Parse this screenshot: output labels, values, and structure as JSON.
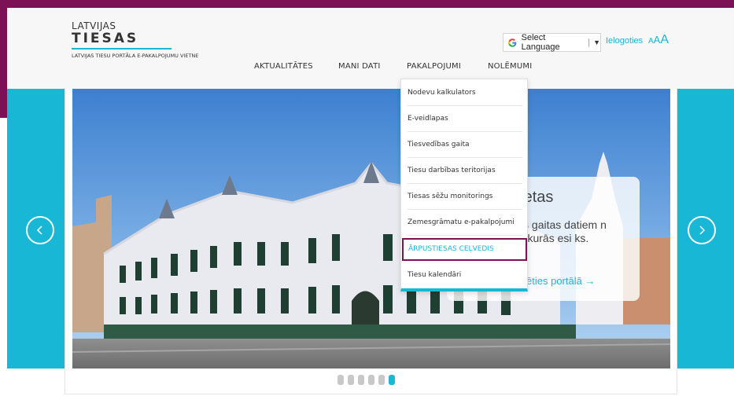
{
  "logo": {
    "line1": "LATVIJAS",
    "line2": "TIESAS",
    "subtitle": "LATVIJAS TIESU PORTĀLA E-PAKALPOJUMU VIETNE"
  },
  "header": {
    "language_label": "Select Language",
    "language_arrow": "▼",
    "login": "Ielogoties",
    "font_size": [
      "A",
      "A",
      "A"
    ]
  },
  "nav": [
    "AKTUALITĀTES",
    "MANI DATI",
    "PAKALPOJUMI",
    "NOLĒMUMI"
  ],
  "dropdown": {
    "items": [
      "Nodevu kalkulators",
      "E-veidlapas",
      "Tiesvedības gaita",
      "Tiesu darbības teritorijas",
      "Tiesas sēžu monitorings",
      "Zemesgrāmatu e-pakalpojumi",
      "ĀRPUSTIESAS CEĻVEDIS",
      "Tiesu kalendāri"
    ],
    "highlighted_index": 6
  },
  "slide": {
    "card_title": "as lietas",
    "card_text": "edības gaitas datiem n lietās, kurās esi ks.",
    "card_link": "autorizēties portālā →"
  },
  "carousel": {
    "dot_count": 6,
    "active_dot": 6
  },
  "colors": {
    "brand": "#7d1155",
    "accent": "#18b7d6"
  }
}
